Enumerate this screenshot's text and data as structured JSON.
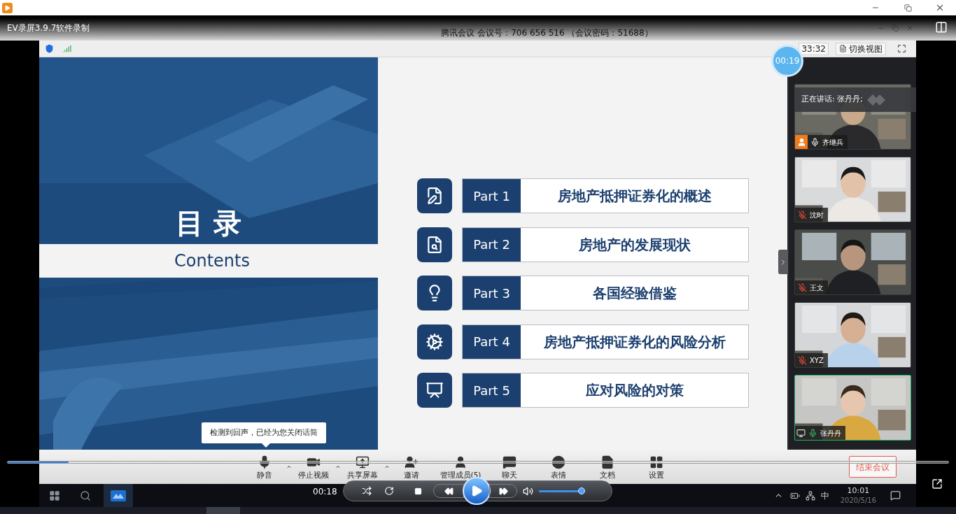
{
  "player": {
    "title": "EV录屏3.9.7软件录制",
    "time": "00:18",
    "progress": {
      "level": 0.065
    },
    "volume": {
      "level": 0.93
    }
  },
  "meeting": {
    "title": "腾讯会议 会议号：706 656 516 （会议密码：51688）",
    "duration": "33:32",
    "switch_view": "切换视图",
    "timer": "00:19",
    "slide": {
      "title": "目 录",
      "subtitle": "Contents",
      "parts": [
        {
          "label": "Part 1",
          "title": "房地产抵押证券化的概述"
        },
        {
          "label": "Part 2",
          "title": "房地产的发展现状"
        },
        {
          "label": "Part 3",
          "title": "各国经验借鉴"
        },
        {
          "label": "Part 4",
          "title": "房地产抵押证券化的风险分析"
        },
        {
          "label": "Part 5",
          "title": "应对风险的对策"
        }
      ]
    },
    "speaking": "正在讲话: 张丹丹;",
    "participants": [
      {
        "name": "齐继兵",
        "kind": "host",
        "muted": false,
        "selected": false
      },
      {
        "name": "沈时",
        "kind": "member",
        "muted": true,
        "selected": false
      },
      {
        "name": "王文",
        "kind": "member",
        "muted": true,
        "selected": false
      },
      {
        "name": "XYZ",
        "kind": "member",
        "muted": true,
        "selected": false
      },
      {
        "name": "张丹丹",
        "kind": "sharer",
        "muted": false,
        "selected": true
      }
    ],
    "tooltip": "检测到回声，已经为您关闭话筒",
    "toolbar": [
      {
        "label": "静音",
        "menu": true
      },
      {
        "label": "停止视频",
        "menu": true
      },
      {
        "label": "共享屏幕",
        "menu": true
      },
      {
        "label": "邀请",
        "menu": false
      },
      {
        "label": "管理成员(5)",
        "menu": false
      },
      {
        "label": "聊天",
        "menu": false
      },
      {
        "label": "表情",
        "menu": false
      },
      {
        "label": "文档",
        "menu": false
      },
      {
        "label": "设置",
        "menu": false
      }
    ],
    "end_button": "结束会议"
  },
  "taskbar": {
    "ime": "中",
    "time": "10:01",
    "date": "2020/5/16"
  }
}
